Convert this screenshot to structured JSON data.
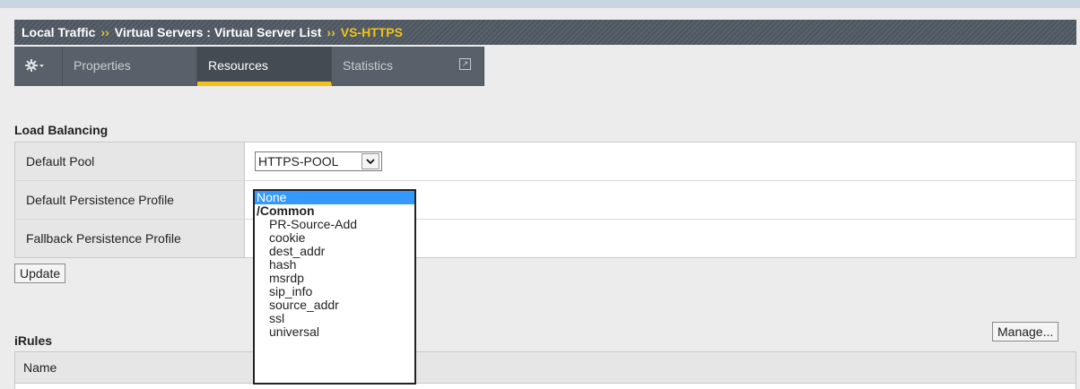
{
  "breadcrumb": {
    "item1": "Local Traffic",
    "sep": "››",
    "item2": "Virtual Servers : Virtual Server List",
    "current": "VS-HTTPS"
  },
  "tabs": {
    "gear_icon": "gear-icon",
    "properties": "Properties",
    "resources": "Resources",
    "statistics": "Statistics",
    "popout_glyph": "↗",
    "active": "Resources"
  },
  "load_balancing": {
    "title": "Load Balancing",
    "rows": [
      {
        "label": "Default Pool",
        "value": "HTTPS-POOL"
      },
      {
        "label": "Default Persistence Profile"
      },
      {
        "label": "Fallback Persistence Profile"
      }
    ],
    "update_label": "Update"
  },
  "persistence_dropdown": {
    "selected": "None",
    "group": "/Common",
    "options": [
      "PR-Source-Add",
      "cookie",
      "dest_addr",
      "hash",
      "msrdp",
      "sip_info",
      "source_addr",
      "ssl",
      "universal"
    ]
  },
  "irules": {
    "title": "iRules",
    "manage_label": "Manage...",
    "column_name": "Name"
  },
  "colors": {
    "accent_tab": "#f2c21b",
    "breadcrumb_current": "#f0c419",
    "selected_option": "#3399ff"
  }
}
